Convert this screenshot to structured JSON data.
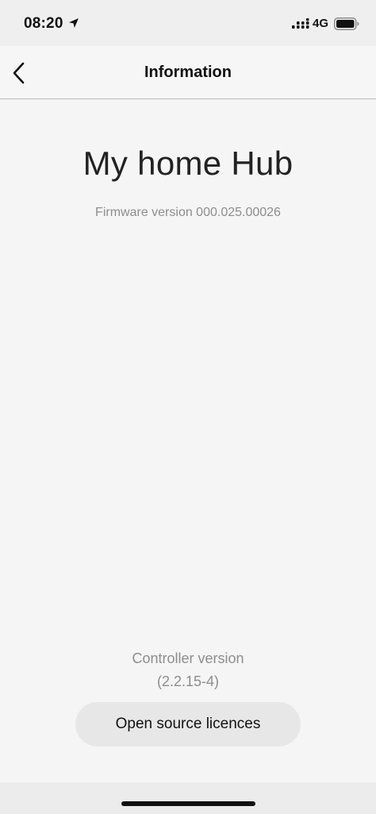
{
  "status_bar": {
    "time": "08:20",
    "network": "4G",
    "icons": [
      "location-arrow-icon",
      "cellular-signal-icon",
      "battery-icon"
    ]
  },
  "nav": {
    "title": "Information",
    "back_icon": "chevron-left-icon"
  },
  "device": {
    "name": "My home Hub",
    "firmware": "Firmware version 000.025.00026"
  },
  "controller": {
    "label": "Controller version",
    "version": "(2.2.15-4)"
  },
  "actions": {
    "licences_label": "Open source licences"
  },
  "colors": {
    "background": "#f5f5f5",
    "secondary_text": "#8d8d8d",
    "button_background": "#e7e7e7"
  }
}
